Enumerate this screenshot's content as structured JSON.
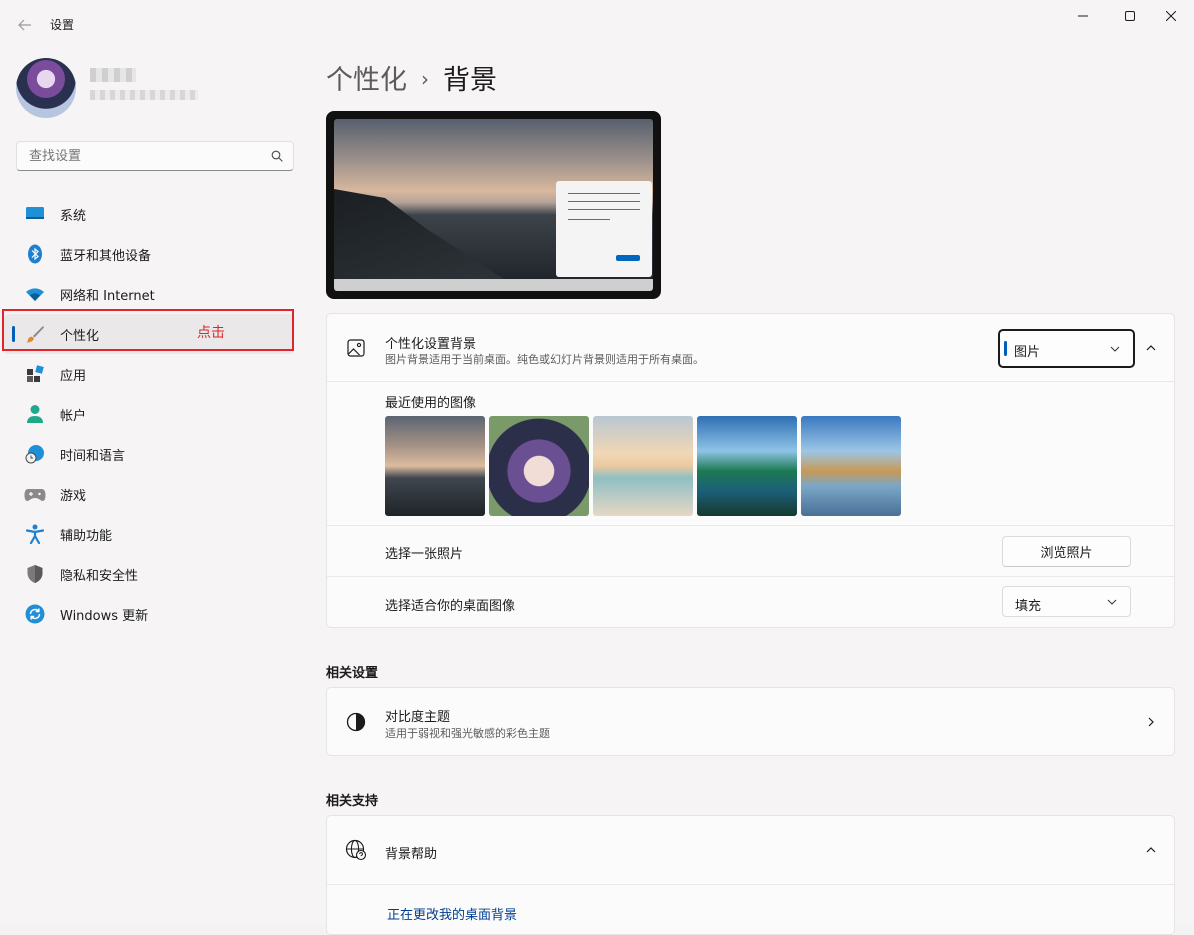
{
  "window": {
    "app_title": "设置"
  },
  "sidebar": {
    "search_placeholder": "查找设置",
    "items": [
      {
        "label": "系统",
        "icon": "monitor-icon"
      },
      {
        "label": "蓝牙和其他设备",
        "icon": "bluetooth-icon"
      },
      {
        "label": "网络和 Internet",
        "icon": "wifi-icon"
      },
      {
        "label": "个性化",
        "icon": "brush-icon",
        "active": true
      },
      {
        "label": "应用",
        "icon": "apps-icon"
      },
      {
        "label": "帐户",
        "icon": "person-icon"
      },
      {
        "label": "时间和语言",
        "icon": "globe-clock-icon"
      },
      {
        "label": "游戏",
        "icon": "gamepad-icon"
      },
      {
        "label": "辅助功能",
        "icon": "accessibility-icon"
      },
      {
        "label": "隐私和安全性",
        "icon": "shield-icon"
      },
      {
        "label": "Windows 更新",
        "icon": "update-icon"
      }
    ],
    "annotation": "点击"
  },
  "main": {
    "breadcrumb_parent": "个性化",
    "breadcrumb_separator": "›",
    "breadcrumb_current": "背景",
    "background_card": {
      "title": "个性化设置背景",
      "subtitle": "图片背景适用于当前桌面。纯色或幻灯片背景则适用于所有桌面。",
      "selected_type": "图片",
      "recent_label": "最近使用的图像",
      "recent_images": [
        "cloudy-coast",
        "anime-character",
        "sunny-beach",
        "waterfall-landscape",
        "rock-arches"
      ],
      "choose_photo_label": "选择一张照片",
      "browse_button": "浏览照片",
      "fit_label": "选择适合你的桌面图像",
      "fit_value": "填充"
    },
    "related_settings": {
      "heading": "相关设置",
      "contrast_title": "对比度主题",
      "contrast_sub": "适用于弱视和强光敏感的彩色主题"
    },
    "related_support": {
      "heading": "相关支持",
      "help_title": "背景帮助",
      "help_link": "正在更改我的桌面背景"
    }
  },
  "colors": {
    "accent": "#005fb8",
    "annotation_red": "#e0262c",
    "link": "#003e92"
  }
}
